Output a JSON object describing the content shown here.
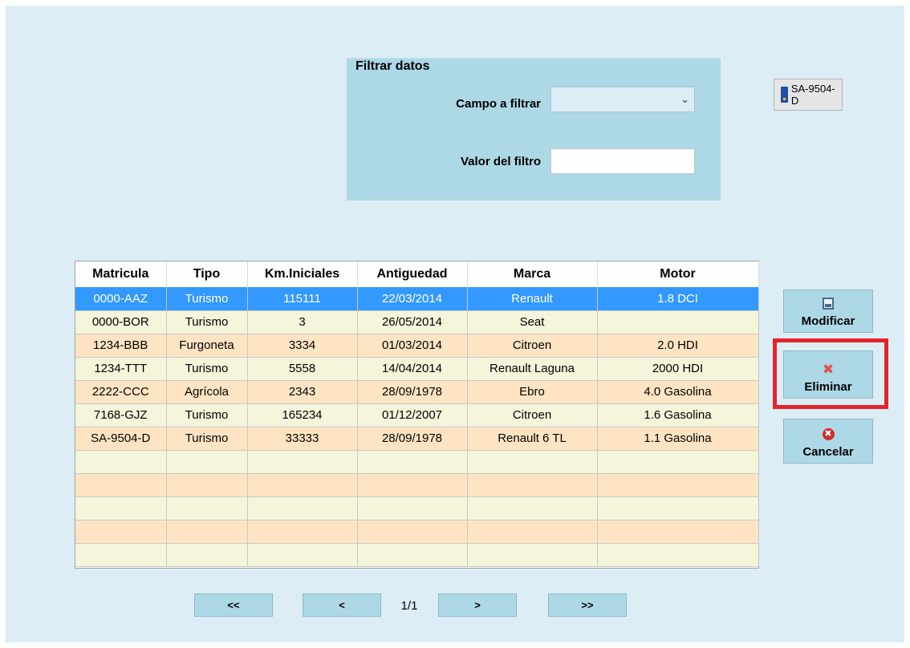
{
  "filter": {
    "title": "Filtrar datos",
    "campo_label": "Campo a filtrar",
    "campo_value": "",
    "valor_label": "Valor del filtro",
    "valor_value": ""
  },
  "plate_button": {
    "label": "SA-9504-D"
  },
  "grid": {
    "columns": [
      "Matricula",
      "Tipo",
      "Km.Iniciales",
      "Antiguedad",
      "Marca",
      "Motor"
    ],
    "rows": [
      [
        "0000-AAZ",
        "Turismo",
        "115111",
        "22/03/2014",
        "Renault",
        "1.8 DCI"
      ],
      [
        "0000-BOR",
        "Turismo",
        "3",
        "26/05/2014",
        "Seat",
        ""
      ],
      [
        "1234-BBB",
        "Furgoneta",
        "3334",
        "01/03/2014",
        "Citroen",
        "2.0 HDI"
      ],
      [
        "1234-TTT",
        "Turismo",
        "5558",
        "14/04/2014",
        "Renault Laguna",
        "2000 HDI"
      ],
      [
        "2222-CCC",
        "Agrícola",
        "2343",
        "28/09/1978",
        "Ebro",
        "4.0 Gasolina"
      ],
      [
        "7168-GJZ",
        "Turismo",
        "165234",
        "01/12/2007",
        "Citroen",
        "1.6 Gasolina"
      ],
      [
        "SA-9504-D",
        "Turismo",
        "33333",
        "28/09/1978",
        "Renault 6 TL",
        "1.1 Gasolina"
      ],
      [
        "",
        "",
        "",
        "",
        "",
        ""
      ],
      [
        "",
        "",
        "",
        "",
        "",
        ""
      ],
      [
        "",
        "",
        "",
        "",
        "",
        ""
      ],
      [
        "",
        "",
        "",
        "",
        "",
        ""
      ],
      [
        "",
        "",
        "",
        "",
        "",
        ""
      ]
    ],
    "selected_row": 0
  },
  "actions": {
    "modificar": "Modificar",
    "eliminar": "Eliminar",
    "cancelar": "Cancelar"
  },
  "paging": {
    "first": "<<",
    "prev": "<",
    "indicator": "1/1",
    "next": ">",
    "last": ">>"
  },
  "colors": {
    "window_bg": "#dcedf6",
    "panel_bg": "#add8e6",
    "row_odd": "#f5f5dc",
    "row_even": "#ffe4c4",
    "row_selected": "#3399ff",
    "highlight": "#e3242b"
  },
  "icons": {
    "plate": "license-plate-icon",
    "modificar": "save-icon",
    "eliminar": "delete-x-icon",
    "cancelar": "cancel-icon",
    "select": "chevron-down-icon"
  }
}
